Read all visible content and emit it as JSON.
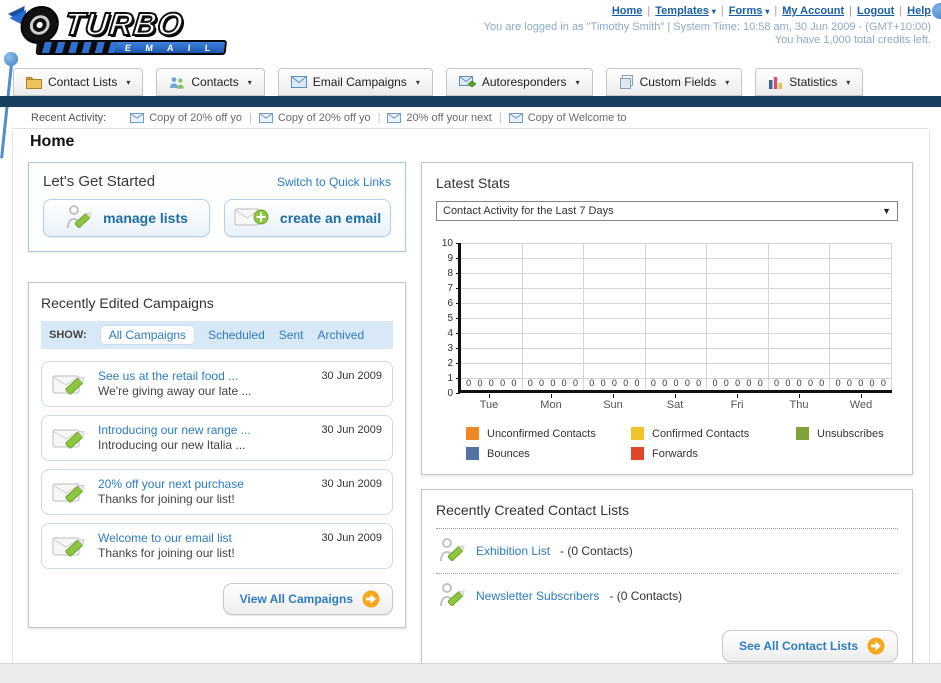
{
  "header": {
    "logo_title": "TURBO",
    "logo_subtitle": "E M A I L",
    "nav_items": [
      {
        "label": "Home",
        "dropdown": false
      },
      {
        "label": "Templates",
        "dropdown": true
      },
      {
        "label": "Forms",
        "dropdown": true
      },
      {
        "label": "My Account",
        "dropdown": false
      },
      {
        "label": "Logout",
        "dropdown": false
      },
      {
        "label": "Help",
        "dropdown": false
      }
    ],
    "status_line1": "You are logged in as \"Timothy Smith\" | System Time: 10:58 am, 30 Jun 2009 - (GMT+10:00)",
    "status_line2": "You have 1,000 total credits left."
  },
  "main_tabs": [
    {
      "label": "Contact Lists",
      "icon": "folder-icon"
    },
    {
      "label": "Contacts",
      "icon": "contacts-icon"
    },
    {
      "label": "Email Campaigns",
      "icon": "envelope-icon"
    },
    {
      "label": "Autoresponders",
      "icon": "autoresponder-icon"
    },
    {
      "label": "Custom Fields",
      "icon": "pages-icon"
    },
    {
      "label": "Statistics",
      "icon": "bar-chart-icon"
    }
  ],
  "recent_activity": {
    "label": "Recent Activity:",
    "items": [
      "Copy of 20% off yo",
      "Copy of 20% off yo",
      "20% off your next",
      "Copy of Welcome to"
    ]
  },
  "page_title": "Home",
  "get_started": {
    "title": "Let's Get Started",
    "switch_link": "Switch to Quick Links",
    "buttons": [
      {
        "label": "manage lists",
        "icon": "person-pencil-icon"
      },
      {
        "label": "create an email",
        "icon": "envelope-plus-icon"
      }
    ]
  },
  "campaigns": {
    "title": "Recently Edited Campaigns",
    "show_label": "SHOW:",
    "filters": [
      "All Campaigns",
      "Scheduled",
      "Sent",
      "Archived"
    ],
    "active_filter": "All Campaigns",
    "items": [
      {
        "title": "See us at the retail food ...",
        "subtitle": "We're giving away our late ...",
        "date": "30 Jun 2009"
      },
      {
        "title": "Introducing our new range ...",
        "subtitle": "Introducing our new Italia ...",
        "date": "30 Jun 2009"
      },
      {
        "title": "20% off your next purchase",
        "subtitle": "Thanks for joining our list!",
        "date": "30 Jun 2009"
      },
      {
        "title": "Welcome to our email list",
        "subtitle": "Thanks for joining our list!",
        "date": "30 Jun 2009"
      }
    ],
    "view_all_label": "View All Campaigns"
  },
  "stats": {
    "title": "Latest Stats",
    "dropdown_value": "Contact Activity for the Last 7 Days",
    "chart_data": {
      "type": "bar",
      "title": "Contact Activity for the Last 7 Days",
      "categories": [
        "Tue",
        "Mon",
        "Sun",
        "Sat",
        "Fri",
        "Thu",
        "Wed"
      ],
      "series": [
        {
          "name": "Unconfirmed Contacts",
          "color": "#F08626",
          "values": [
            0,
            0,
            0,
            0,
            0,
            0,
            0
          ]
        },
        {
          "name": "Confirmed Contacts",
          "color": "#F2C12E",
          "values": [
            0,
            0,
            0,
            0,
            0,
            0,
            0
          ]
        },
        {
          "name": "Unsubscribes",
          "color": "#7FA33A",
          "values": [
            0,
            0,
            0,
            0,
            0,
            0,
            0
          ]
        },
        {
          "name": "Bounces",
          "color": "#5572A7",
          "values": [
            0,
            0,
            0,
            0,
            0,
            0,
            0
          ]
        },
        {
          "name": "Forwards",
          "color": "#E04728",
          "values": [
            0,
            0,
            0,
            0,
            0,
            0,
            0
          ]
        }
      ],
      "ylim": [
        0,
        10
      ],
      "ytick_step": 1,
      "grid": true,
      "value_labels_shown": true,
      "legend_position": "bottom"
    }
  },
  "contact_lists": {
    "title": "Recently Created Contact Lists",
    "items": [
      {
        "name": "Exhibition List",
        "detail": "- (0 Contacts)"
      },
      {
        "name": "Newsletter Subscribers",
        "detail": "- (0 Contacts)"
      }
    ],
    "see_all_label": "See All Contact Lists"
  },
  "colors": {
    "accent_blue": "#2d7dc2",
    "navy_bar": "#163f5f",
    "orange_action": "#f5a81c"
  }
}
